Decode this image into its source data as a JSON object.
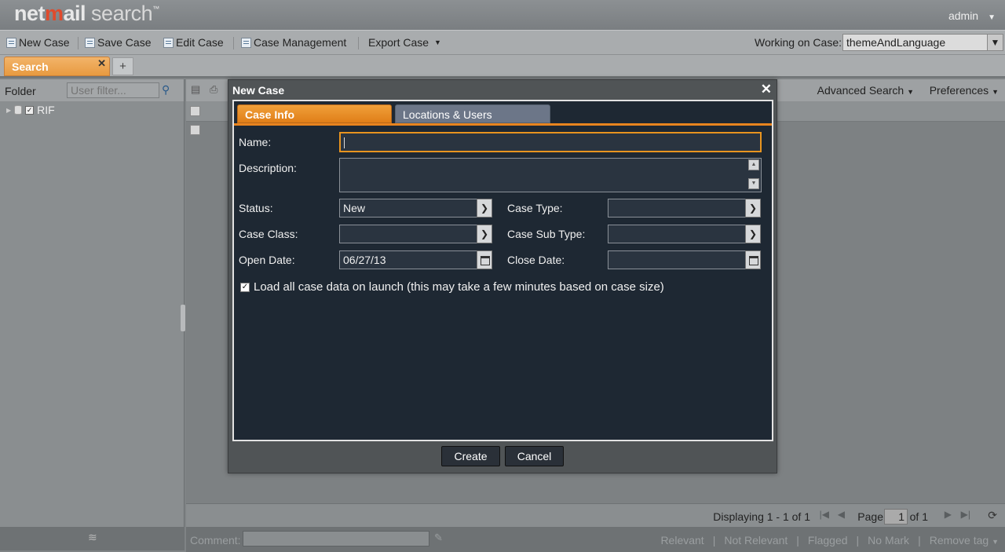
{
  "header": {
    "logo_net": "net",
    "logo_m": "m",
    "logo_ail": "ail",
    "logo_search": " search",
    "logo_tm": "™",
    "user": "admin"
  },
  "toolbar": {
    "new_case": "New Case",
    "save_case": "Save Case",
    "edit_case": "Edit Case",
    "case_management": "Case Management",
    "export_case": "Export Case",
    "working_label": "Working on Case:",
    "working_value": "themeAndLanguage"
  },
  "tabs": {
    "search": "Search",
    "add": "+"
  },
  "left": {
    "folder_label": "Folder",
    "filter_placeholder": "User filter...",
    "tree_item": "RIF"
  },
  "main": {
    "advanced_search": "Advanced Search",
    "preferences": "Preferences"
  },
  "paging": {
    "displaying": "Displaying 1 - 1 of 1",
    "page_label": "Page",
    "page_value": "1",
    "of_label": "of 1"
  },
  "comment": {
    "label": "Comment:",
    "marks": [
      "Relevant",
      "Not Relevant",
      "Flagged",
      "No Mark",
      "Remove tag"
    ]
  },
  "modal": {
    "title": "New Case",
    "tab_case_info": "Case Info",
    "tab_locations": "Locations & Users",
    "name_label": "Name:",
    "name_value": "",
    "description_label": "Description:",
    "status_label": "Status:",
    "status_value": "New",
    "case_type_label": "Case Type:",
    "case_type_value": "",
    "case_class_label": "Case Class:",
    "case_class_value": "",
    "case_sub_type_label": "Case Sub Type:",
    "case_sub_type_value": "",
    "open_date_label": "Open Date:",
    "open_date_value": "06/27/13",
    "close_date_label": "Close Date:",
    "close_date_value": "",
    "load_all_label": "Load all case data on launch (this may take a few minutes based on case size)",
    "load_all_checked": true,
    "create_button": "Create",
    "cancel_button": "Cancel"
  }
}
